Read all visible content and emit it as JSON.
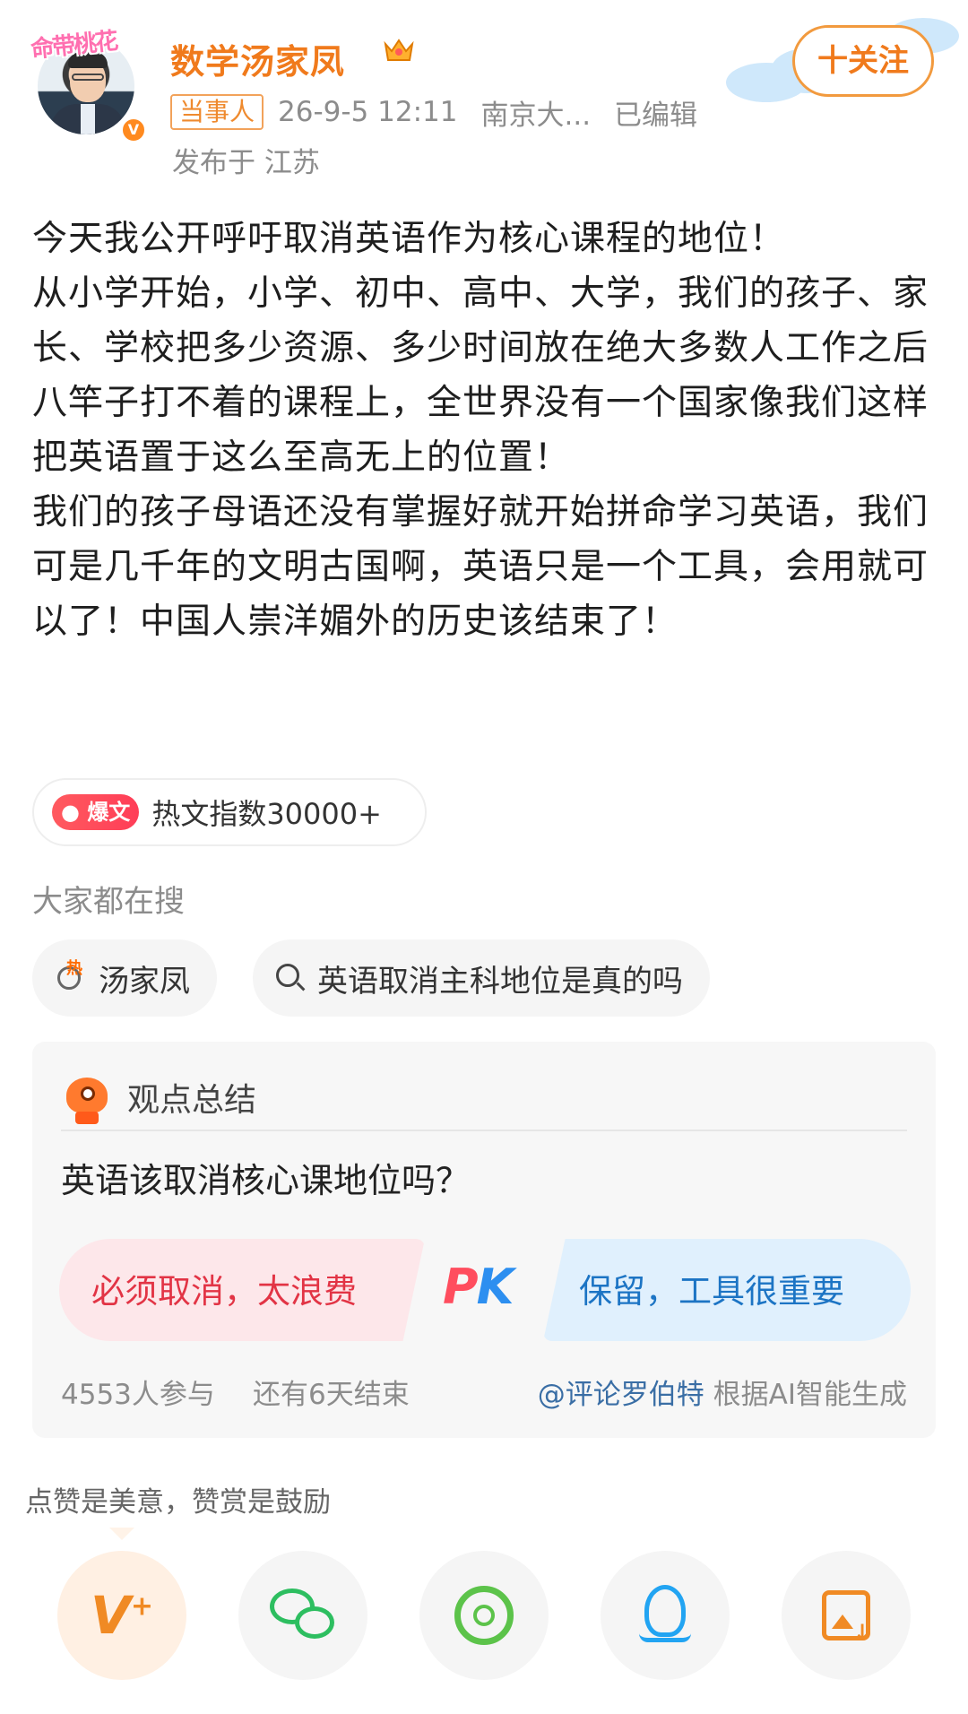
{
  "header": {
    "avatar_frame_text": "命带桃花",
    "username": "数学汤家凤",
    "tag": "当事人",
    "datetime": "26-9-5 12:11",
    "source": "南京大...",
    "edited": "已编辑",
    "location": "发布于 江苏",
    "follow_label": "十关注",
    "crown_icon": "crown-icon",
    "verified_icon": "verified-v-icon"
  },
  "post": {
    "paragraphs": [
      "今天我公开呼吁取消英语作为核心课程的地位！",
      "从小学开始，小学、初中、高中、大学，我们的孩子、家长、学校把多少资源、多少时间放在绝大多数人工作之后八竿子打不着的课程上，全世界没有一个国家像我们这样把英语置于这么至高无上的位置！",
      "我们的孩子母语还没有掌握好就开始拼命学习英语，我们可是几千年的文明古国啊，英语只是一个工具，会用就可以了！中国人崇洋媚外的历史该结束了！"
    ]
  },
  "hot": {
    "badge": "爆文",
    "text": "热文指数30000+"
  },
  "search": {
    "title": "大家都在搜",
    "chips": [
      "汤家凤",
      "英语取消主科地位是真的吗"
    ]
  },
  "opinion": {
    "title": "观点总结",
    "question": "英语该取消核心课地位吗？",
    "left": "必须取消，太浪费",
    "pk_p": "P",
    "pk_k": "K",
    "right": "保留，工具很重要",
    "participants": "4553人参与",
    "ends": "还有6天结束",
    "ai_link": "@评论罗伯特",
    "ai_text": " 根据AI智能生成"
  },
  "appreciate": {
    "text": "点赞是美意，赞赏是鼓励",
    "reward_label": "V"
  },
  "colors": {
    "brand_orange": "#f07a1c",
    "pk_red": "#ff4d5e",
    "pk_blue": "#2d8ff0",
    "wechat_green": "#2dbe60",
    "qq_blue": "#22a4f2"
  }
}
